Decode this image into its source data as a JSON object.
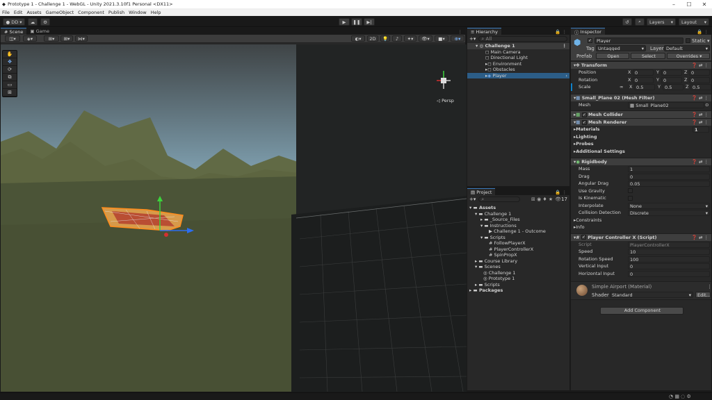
{
  "window": {
    "title": "Prototype 1 - Challenge 1 - WebGL - Unity 2021.3.10f1 Personal <DX11>"
  },
  "menu": [
    "File",
    "Edit",
    "Assets",
    "GameObject",
    "Component",
    "Publish",
    "Window",
    "Help"
  ],
  "toolbar": {
    "account": "DD",
    "layers": "Layers",
    "layout": "Layout"
  },
  "scene": {
    "tab_scene": "Scene",
    "tab_game": "Game",
    "mode_2d": "2D",
    "persp": "◁ Persp",
    "gizmo_count": ""
  },
  "hierarchy": {
    "title": "Hierarchy",
    "search": "All",
    "items": [
      {
        "label": "Challenge 1",
        "indent": 0
      },
      {
        "label": "Main Camera",
        "indent": 1
      },
      {
        "label": "Directional Light",
        "indent": 1
      },
      {
        "label": "Environment",
        "indent": 1
      },
      {
        "label": "Obstacles",
        "indent": 1
      },
      {
        "label": "Player",
        "indent": 1
      }
    ]
  },
  "project": {
    "title": "Project",
    "badge": "17",
    "items": [
      {
        "label": "Assets",
        "indent": 0
      },
      {
        "label": "Challenge 1",
        "indent": 1
      },
      {
        "label": "_Source_Files",
        "indent": 2
      },
      {
        "label": "Instructions",
        "indent": 2
      },
      {
        "label": "Challenge 1 - Outcome",
        "indent": 3
      },
      {
        "label": "Scripts",
        "indent": 2
      },
      {
        "label": "FollowPlayerX",
        "indent": 3
      },
      {
        "label": "PlayerControllerX",
        "indent": 3
      },
      {
        "label": "SpinPropX",
        "indent": 3
      },
      {
        "label": "Course Library",
        "indent": 1
      },
      {
        "label": "Scenes",
        "indent": 1
      },
      {
        "label": "Challenge 1",
        "indent": 2
      },
      {
        "label": "Prototype 1",
        "indent": 2
      },
      {
        "label": "Scripts",
        "indent": 1
      },
      {
        "label": "Packages",
        "indent": 0
      }
    ]
  },
  "inspector": {
    "title": "Inspector",
    "name": "Player",
    "static_label": "Static",
    "tag_label": "Tag",
    "tag_value": "Untagged",
    "layer_label": "Layer",
    "layer_value": "Default",
    "prefab_label": "Prefab",
    "prefab_open": "Open",
    "prefab_select": "Select",
    "prefab_overrides": "Overrides",
    "transform": {
      "title": "Transform",
      "position": {
        "label": "Position",
        "x": "0",
        "y": "0",
        "z": "0"
      },
      "rotation": {
        "label": "Rotation",
        "x": "0",
        "y": "0",
        "z": "0"
      },
      "scale": {
        "label": "Scale",
        "x": "0.5",
        "y": "0.5",
        "z": "0.5"
      },
      "xl": "X",
      "yl": "Y",
      "zl": "Z"
    },
    "mesh_filter": {
      "title": "Small_Plane 02 (Mesh Filter)",
      "mesh_label": "Mesh",
      "mesh_value": "Small_Plane02"
    },
    "mesh_collider": {
      "title": "Mesh Collider"
    },
    "mesh_renderer": {
      "title": "Mesh Renderer",
      "materials": "Materials",
      "materials_count": "1",
      "lighting": "Lighting",
      "probes": "Probes",
      "additional": "Additional Settings"
    },
    "rigidbody": {
      "title": "Rigidbody",
      "mass_label": "Mass",
      "mass": "1",
      "drag_label": "Drag",
      "drag": "0",
      "angular_label": "Angular Drag",
      "angular": "0.05",
      "gravity_label": "Use Gravity",
      "kinematic_label": "Is Kinematic",
      "interp_label": "Interpolate",
      "interp": "None",
      "collision_label": "Collision Detection",
      "collision": "Discrete",
      "constraints": "Constraints",
      "info": "Info"
    },
    "script": {
      "title": "Player Controller X (Script)",
      "script_label": "Script",
      "script_value": "PlayerControllerX",
      "speed_label": "Speed",
      "speed": "10",
      "rot_label": "Rotation Speed",
      "rot": "100",
      "vert_label": "Vertical Input",
      "vert": "0",
      "horiz_label": "Horizontal Input",
      "horiz": "0"
    },
    "material": {
      "title": "Simple Airport (Material)",
      "shader_label": "Shader",
      "shader_value": "Standard",
      "edit": "Edit..."
    },
    "add_component": "Add Component"
  },
  "colors": {
    "accent": "#2c5d87",
    "sky": "#8fb0c0",
    "ground": "#4b5437"
  }
}
